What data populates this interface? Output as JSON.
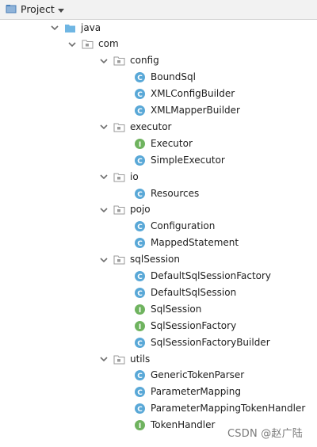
{
  "header": {
    "title": "Project"
  },
  "tree": [
    {
      "depth": 0,
      "expand": true,
      "icon": "folder-blue-icon",
      "label": "java"
    },
    {
      "depth": 1,
      "expand": true,
      "icon": "package-icon",
      "label": "com"
    },
    {
      "depth": 2,
      "expand": true,
      "icon": "package-icon",
      "label": "config"
    },
    {
      "depth": 3,
      "expand": false,
      "icon": "class-icon",
      "label": "BoundSql"
    },
    {
      "depth": 3,
      "expand": false,
      "icon": "class-icon",
      "label": "XMLConfigBuilder"
    },
    {
      "depth": 3,
      "expand": false,
      "icon": "class-icon",
      "label": "XMLMapperBuilder"
    },
    {
      "depth": 2,
      "expand": true,
      "icon": "package-icon",
      "label": "executor"
    },
    {
      "depth": 3,
      "expand": false,
      "icon": "interface-icon",
      "label": "Executor"
    },
    {
      "depth": 3,
      "expand": false,
      "icon": "class-icon",
      "label": "SimpleExecutor"
    },
    {
      "depth": 2,
      "expand": true,
      "icon": "package-icon",
      "label": "io"
    },
    {
      "depth": 3,
      "expand": false,
      "icon": "class-icon",
      "label": "Resources"
    },
    {
      "depth": 2,
      "expand": true,
      "icon": "package-icon",
      "label": "pojo"
    },
    {
      "depth": 3,
      "expand": false,
      "icon": "class-icon",
      "label": "Configuration"
    },
    {
      "depth": 3,
      "expand": false,
      "icon": "class-icon",
      "label": "MappedStatement"
    },
    {
      "depth": 2,
      "expand": true,
      "icon": "package-icon",
      "label": "sqlSession"
    },
    {
      "depth": 3,
      "expand": false,
      "icon": "class-icon",
      "label": "DefaultSqlSessionFactory"
    },
    {
      "depth": 3,
      "expand": false,
      "icon": "class-icon",
      "label": "DefaultSqlSession"
    },
    {
      "depth": 3,
      "expand": false,
      "icon": "interface-icon",
      "label": "SqlSession"
    },
    {
      "depth": 3,
      "expand": false,
      "icon": "interface-icon",
      "label": "SqlSessionFactory"
    },
    {
      "depth": 3,
      "expand": false,
      "icon": "class-icon",
      "label": "SqlSessionFactoryBuilder"
    },
    {
      "depth": 2,
      "expand": true,
      "icon": "package-icon",
      "label": "utils"
    },
    {
      "depth": 3,
      "expand": false,
      "icon": "class-icon",
      "label": "GenericTokenParser"
    },
    {
      "depth": 3,
      "expand": false,
      "icon": "class-icon",
      "label": "ParameterMapping"
    },
    {
      "depth": 3,
      "expand": false,
      "icon": "class-icon",
      "label": "ParameterMappingTokenHandler"
    },
    {
      "depth": 3,
      "expand": false,
      "icon": "interface-icon",
      "label": "TokenHandler"
    }
  ],
  "watermark": "CSDN @赵广陆",
  "colors": {
    "class": "#59a8d7",
    "interface": "#6fb35f",
    "folder": "#6fb6e3",
    "package": "#9a9a9a",
    "chevron": "#6e6e6e"
  }
}
